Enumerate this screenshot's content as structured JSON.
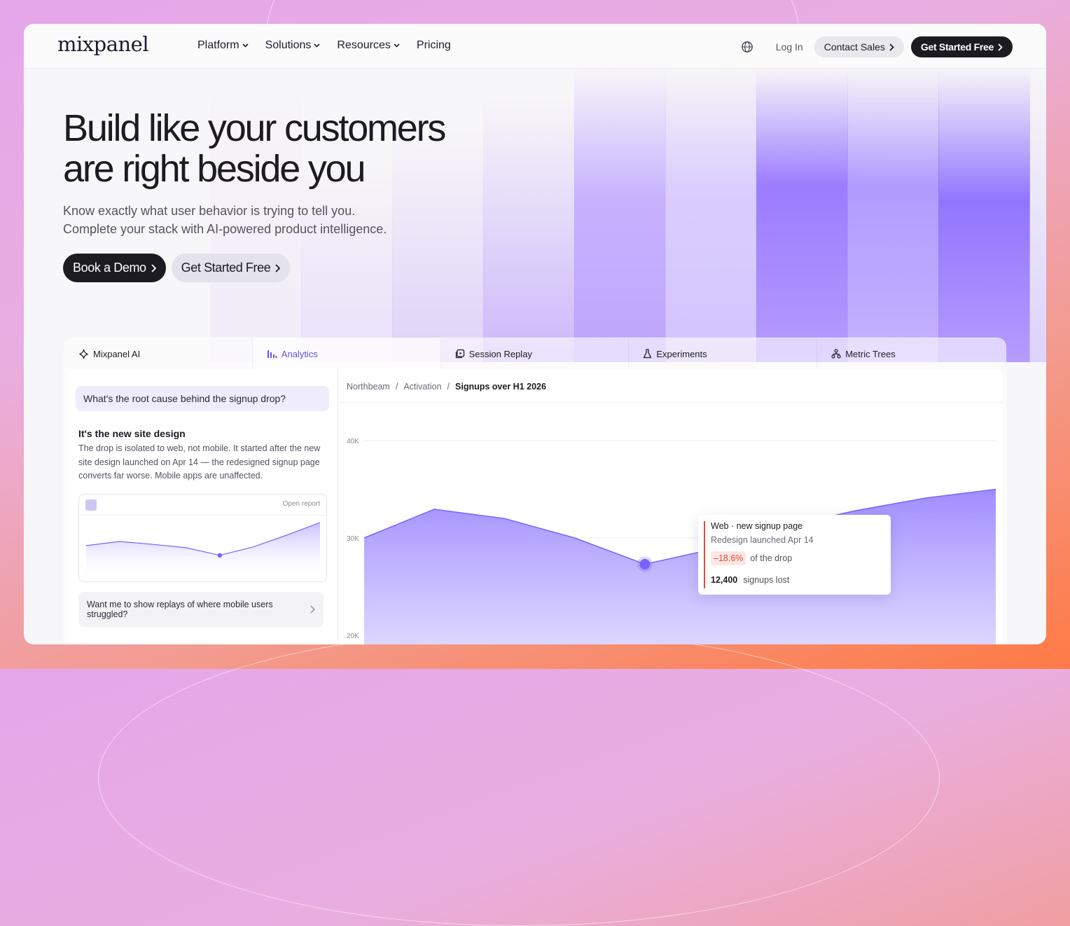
{
  "brand": {
    "logo_text": "mixpanel"
  },
  "nav": {
    "links": [
      {
        "label": "Platform",
        "dropdown": true
      },
      {
        "label": "Solutions",
        "dropdown": true
      },
      {
        "label": "Resources",
        "dropdown": true
      },
      {
        "label": "Pricing",
        "dropdown": false
      }
    ],
    "login": "Log In",
    "contact_sales": "Contact Sales",
    "get_started": "Get Started Free"
  },
  "hero": {
    "headline_line1": "Build like your customers",
    "headline_line2": "are right beside you",
    "sub_line1": "Know exactly what user behavior is trying to tell you.",
    "sub_line2": "Complete your stack with AI-powered product intelligence.",
    "primary_cta": "Book a Demo",
    "secondary_cta": "Get Started Free"
  },
  "product": {
    "tabs": [
      {
        "label": "Mixpanel AI",
        "icon": "sparkle-icon"
      },
      {
        "label": "Analytics",
        "icon": "bar-chart-icon"
      },
      {
        "label": "Session Replay",
        "icon": "replay-icon"
      },
      {
        "label": "Experiments",
        "icon": "flask-icon"
      },
      {
        "label": "Metric Trees",
        "icon": "tree-icon"
      }
    ],
    "active_tab": "Analytics",
    "assistant": {
      "question": "What's the root cause behind the signup drop?",
      "answer_title": "It's the new site design",
      "answer_body": "The drop is isolated to web, not mobile. It started after the new site design launched on Apr 14 — the redesigned signup page converts far worse. Mobile apps are unaffected.",
      "mini_link": "Open report",
      "suggestion": "Want me to show replays of where mobile users struggled?"
    },
    "report": {
      "breadcrumb": [
        "Northbeam",
        "Activation",
        "Signups over H1 2026"
      ],
      "tooltip": {
        "title": "Web · new signup page",
        "subtitle": "Redesign launched Apr 14",
        "change": "–18.6%",
        "change_label": "of the drop",
        "lost_value": "12,400",
        "lost_label": "signups lost"
      }
    }
  },
  "chart_data": {
    "type": "area",
    "yticks": [
      "40K",
      "30K",
      "20K"
    ],
    "ylim": [
      20000,
      40000
    ],
    "values": [
      30000,
      32950,
      32000,
      30000,
      27300,
      28900,
      31200,
      32800,
      34100,
      35000
    ],
    "highlight_index": 4,
    "color": "#7b61ff",
    "mini_values": [
      0.45,
      0.55,
      0.48,
      0.4,
      0.22,
      0.42,
      0.7,
      1.0
    ],
    "mini_highlight_index": 4
  }
}
